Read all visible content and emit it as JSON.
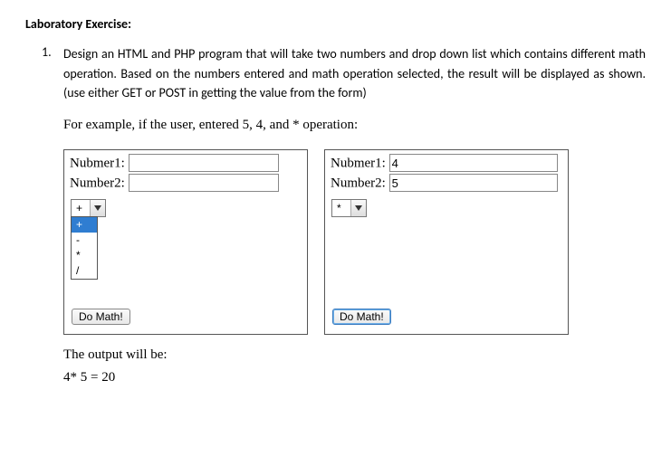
{
  "heading": "Laboratory Exercise:",
  "item_number": "1.",
  "description": "Design an HTML and PHP program that will take two numbers and drop down list which contains different math operation. Based on the numbers entered and math operation selected, the result will be displayed as shown. (use either GET or POST in getting the value from the form)",
  "example_intro": "For example, if the user, entered 5, 4, and * operation:",
  "left_panel": {
    "label1": "Nubmer1:",
    "value1": "",
    "label2": "Number2:",
    "value2": "",
    "selected_op": "+",
    "options": [
      "+",
      "-",
      "*",
      "/"
    ],
    "submit": "Do Math!"
  },
  "right_panel": {
    "label1": "Nubmer1:",
    "value1": "4",
    "label2": "Number2:",
    "value2": "5",
    "selected_op": "*",
    "submit": "Do Math!"
  },
  "output_label": "The output will be:",
  "output_expr": "4* 5 = 20"
}
